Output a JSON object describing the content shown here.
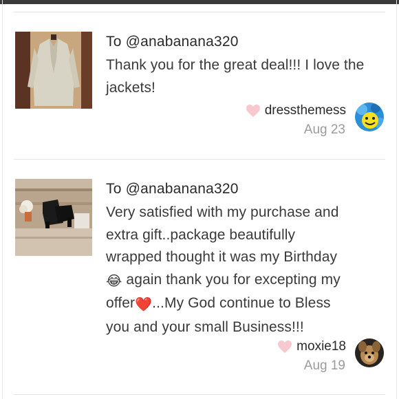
{
  "reviews": [
    {
      "to_line": "To @anabanana320",
      "body": "Thank you for the great deal!!! I love the jackets!",
      "author": "dressthemess",
      "date": "Aug 23",
      "thumb_icon": "jacket-on-mannequin",
      "avatar_icon": "blue-smiley-avatar"
    },
    {
      "to_line": "To @anabanana320",
      "body_lines": [
        "Very satisfied with my purchase and",
        "extra gift..package beautifully",
        "wrapped thought it was my Birthday",
        "again thank you for excepting my",
        "offer",
        "...My God continue to Bless",
        "you and your small Business!!!"
      ],
      "emoji_laugh": "😂",
      "emoji_heart": "❤️",
      "author": "moxie18",
      "date": "Aug 19",
      "thumb_icon": "black-sandals-photo",
      "avatar_icon": "dog-photo-avatar"
    }
  ],
  "colors": {
    "heart": "#f7c9cf",
    "divider": "#e3e3e3",
    "date": "#9b9b9b",
    "text": "#3a3a3a"
  }
}
